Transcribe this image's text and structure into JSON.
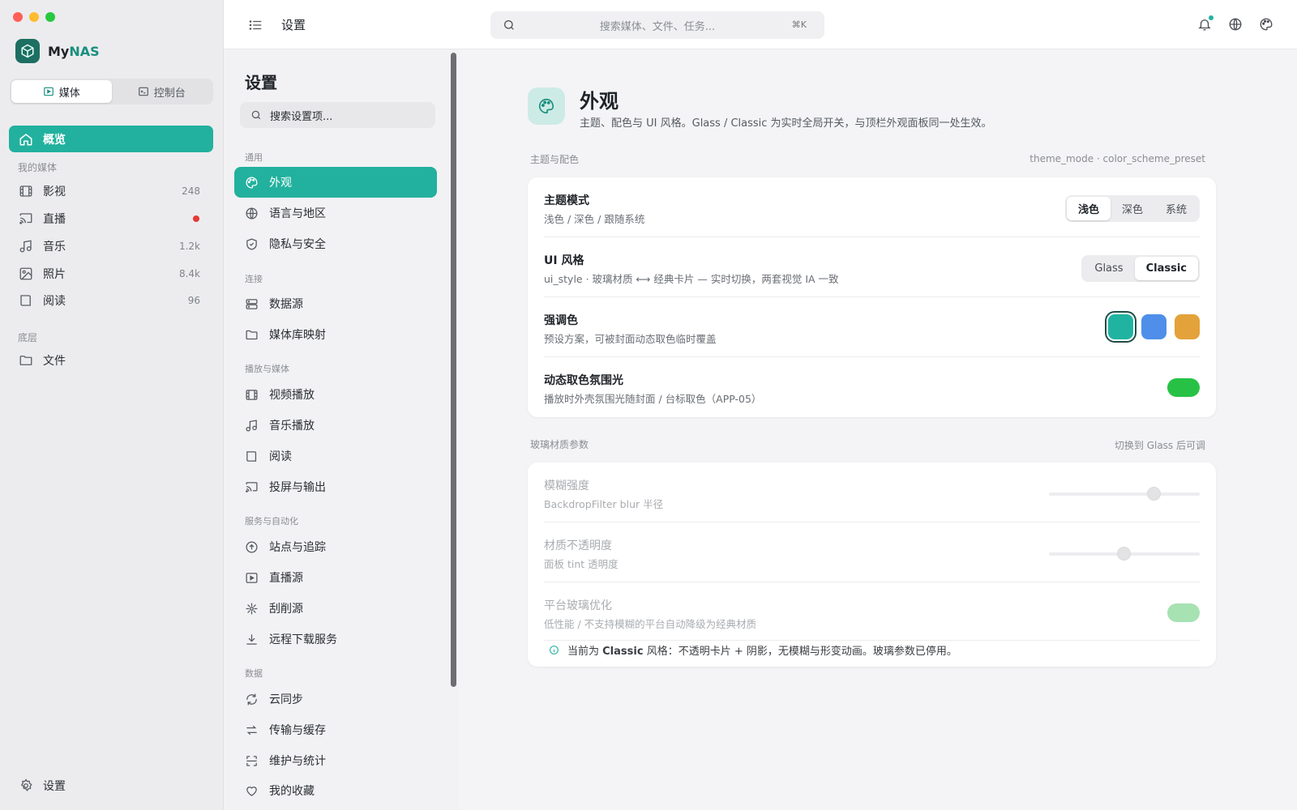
{
  "app": {
    "name_prefix": "My",
    "name_suffix": "NAS",
    "mode_tabs": [
      {
        "label": "媒体",
        "active": true
      },
      {
        "label": "控制台",
        "active": false
      }
    ],
    "primary_nav": {
      "label": "概览"
    },
    "sections": [
      {
        "label": "我的媒体",
        "items": [
          {
            "label": "影视",
            "count": "248",
            "icon": "film-icon"
          },
          {
            "label": "直播",
            "count": "",
            "live_dot": true,
            "icon": "cast-icon"
          },
          {
            "label": "音乐",
            "count": "1.2k",
            "icon": "music-note-icon"
          },
          {
            "label": "照片",
            "count": "8.4k",
            "icon": "image-icon"
          },
          {
            "label": "阅读",
            "count": "96",
            "icon": "book-icon"
          }
        ]
      },
      {
        "label": "底层",
        "items": [
          {
            "label": "文件",
            "count": "",
            "icon": "folder-icon"
          }
        ]
      }
    ],
    "footer_item": {
      "label": "设置",
      "icon": "gear-icon"
    }
  },
  "topbar": {
    "title": "设置",
    "search_placeholder": "搜索媒体、文件、任务...",
    "shortcut": "⌘K"
  },
  "settings_nav": {
    "title": "设置",
    "search_placeholder": "搜索设置项...",
    "groups": [
      {
        "label": "通用",
        "items": [
          {
            "label": "外观",
            "icon": "palette-icon",
            "active": true
          },
          {
            "label": "语言与地区",
            "icon": "globe-icon"
          },
          {
            "label": "隐私与安全",
            "icon": "shield-icon"
          }
        ]
      },
      {
        "label": "连接",
        "items": [
          {
            "label": "数据源",
            "icon": "server-icon"
          },
          {
            "label": "媒体库映射",
            "icon": "folder-icon"
          }
        ]
      },
      {
        "label": "播放与媒体",
        "items": [
          {
            "label": "视频播放",
            "icon": "film-icon"
          },
          {
            "label": "音乐播放",
            "icon": "music-note-icon"
          },
          {
            "label": "阅读",
            "icon": "book-icon"
          },
          {
            "label": "投屏与输出",
            "icon": "cast-icon"
          }
        ]
      },
      {
        "label": "服务与自动化",
        "items": [
          {
            "label": "站点与追踪",
            "icon": "upload-circle-icon"
          },
          {
            "label": "直播源",
            "icon": "play-box-icon"
          },
          {
            "label": "刮削源",
            "icon": "sparkle-icon"
          },
          {
            "label": "远程下载服务",
            "icon": "download-icon"
          }
        ]
      },
      {
        "label": "数据",
        "items": [
          {
            "label": "云同步",
            "icon": "refresh-icon"
          },
          {
            "label": "传输与缓存",
            "icon": "transfer-icon"
          },
          {
            "label": "维护与统计",
            "icon": "scan-icon"
          },
          {
            "label": "我的收藏",
            "icon": "heart-icon"
          }
        ]
      }
    ]
  },
  "page": {
    "title": "外观",
    "description": "主题、配色与 UI 风格。Glass / Classic 为实时全局开关，与顶栏外观面板同一处生效。",
    "theme_card": {
      "label": "主题与配色",
      "meta": "theme_mode · color_scheme_preset",
      "rows": {
        "theme_mode": {
          "title": "主题模式",
          "desc": "浅色 / 深色 / 跟随系统",
          "options": [
            "浅色",
            "深色",
            "系统"
          ],
          "selected": 0
        },
        "ui_style": {
          "title": "UI 风格",
          "desc": "ui_style · 玻璃材质 ⟷ 经典卡片 — 实时切换，两套视觉 IA 一致",
          "options": [
            "Glass",
            "Classic"
          ],
          "selected": 1
        },
        "accent": {
          "title": "强调色",
          "desc": "预设方案，可被封面动态取色临时覆盖",
          "swatches": [
            "#21b3a1",
            "#4f8fea",
            "#e4a23a"
          ],
          "selected": 0
        },
        "dynamic_glow": {
          "title": "动态取色氛围光",
          "desc": "播放时外壳氛围光随封面 / 台标取色（APP-05）",
          "enabled": true
        }
      }
    },
    "glass_card": {
      "label": "玻璃材质参数",
      "meta": "切换到 Glass 后可调",
      "rows": {
        "blur": {
          "title": "模糊强度",
          "desc": "BackdropFilter blur 半径",
          "value": 0.7
        },
        "opacity": {
          "title": "材质不透明度",
          "desc": "面板 tint 透明度",
          "value": 0.5
        },
        "platform": {
          "title": "平台玻璃优化",
          "desc": "低性能 / 不支持模糊的平台自动降级为经典材质",
          "enabled": true
        }
      },
      "note_prefix": "当前为 ",
      "note_bold": "Classic",
      "note_suffix": " 风格：不透明卡片 + 阴影，无模糊与形变动画。玻璃参数已停用。"
    }
  },
  "colors": {
    "accent": "#22b19e",
    "toggle_on": "#27c245",
    "live_dot": "#e53935"
  }
}
